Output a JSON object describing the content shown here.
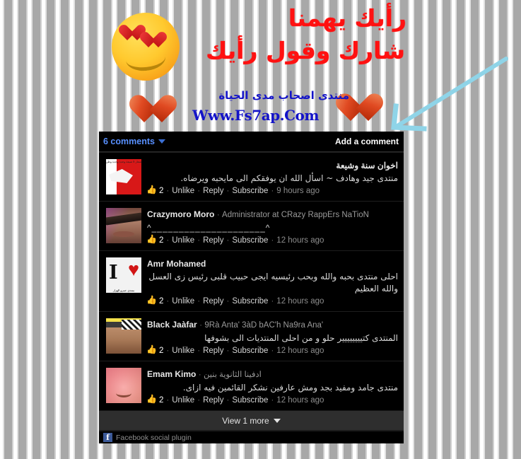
{
  "banner": {
    "headline_1": "رأيك يهمنا",
    "headline_2": "شارك وقول رأيك",
    "subtitle": "منتدى اصحاب مدى الحياة",
    "url": "Www.Fs7ap.Com",
    "headline_color": "#ff1111",
    "subtitle_color": "#1414c8",
    "arrow_color": "#8fd4e8",
    "icons": [
      "heart-eyes-smiley-icon",
      "heart-icon",
      "heart-icon",
      "arrow-pointer-icon"
    ]
  },
  "plugin": {
    "comments_count_label": "6 comments",
    "add_comment_label": "Add a comment",
    "view_more_label": "View 1 more",
    "footer_label": "Facebook social plugin",
    "link_color": "#5890ff"
  },
  "actions": {
    "like_count": "2",
    "unlike": "Unlike",
    "reply": "Reply",
    "subscribe": "Subscribe",
    "separator": "·"
  },
  "comments": [
    {
      "author": "اخوان سنة وشيعة",
      "affiliation": "",
      "text": "منتدى جيد وهادف ~ اسأل الله ان يوفقكم الى مايحبه ويرضاه.",
      "time": "9 hours ago",
      "likes": "2",
      "avatar_caption": "شعار لا شيعة وحدة وحدة وطن",
      "rtl_name": true
    },
    {
      "author": "Crazymoro Moro",
      "affiliation": "Administrator at CRazy RappErs NaTioN",
      "text": "^_____________________^",
      "time": "12 hours ago",
      "likes": "2",
      "avatar_caption": "",
      "rtl_name": false
    },
    {
      "author": "Amr Mohamed",
      "affiliation": "",
      "text": "احلى منتدى بحبه والله وبحب رئيسيه ايجى حبيب قلبى رئيس زى العسل والله العظيم",
      "time": "12 hours ago",
      "likes": "2",
      "avatar_caption": "منتدى عمرو الهزار",
      "rtl_name": false
    },
    {
      "author": "Black Jaàfar",
      "affiliation": "9Rà Anta' 3àD bAC'h Na9ra Ana'",
      "text": "المنتدى كتيييييييير حلو و من احلى المنتديات الى بشوفها",
      "time": "12 hours ago",
      "likes": "2",
      "avatar_caption": "",
      "rtl_name": false
    },
    {
      "author": "Emam Kimo",
      "affiliation": "ادفينا الثانوية بنين",
      "text": "منتدى جامد ومفيد بجد ومش عارفين نشكر القائمين فيه ازاى.",
      "time": "12 hours ago",
      "likes": "2",
      "avatar_caption": "",
      "rtl_name": false
    }
  ]
}
